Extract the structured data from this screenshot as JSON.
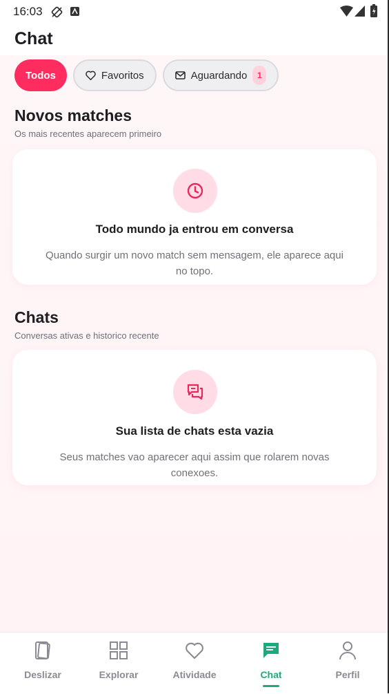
{
  "status_bar": {
    "time": "16:03"
  },
  "header": {
    "title": "Chat"
  },
  "filters": {
    "todos": "Todos",
    "favoritos": "Favoritos",
    "aguardando": "Aguardando",
    "aguardando_count": "1"
  },
  "new_matches": {
    "title": "Novos matches",
    "subtitle": "Os mais recentes aparecem primeiro",
    "empty_title": "Todo mundo ja entrou em conversa",
    "empty_text": "Quando surgir um novo match sem mensagem, ele aparece aqui no topo."
  },
  "chats": {
    "title": "Chats",
    "subtitle": "Conversas ativas e historico recente",
    "empty_title": "Sua lista de chats esta vazia",
    "empty_text": "Seus matches vao aparecer aqui assim que rolarem novas conexoes."
  },
  "nav": {
    "deslizar": "Deslizar",
    "explorar": "Explorar",
    "atividade": "Atividade",
    "chat": "Chat",
    "perfil": "Perfil"
  },
  "colors": {
    "accent": "#ff2d5f",
    "nav_active": "#1ea97c"
  }
}
